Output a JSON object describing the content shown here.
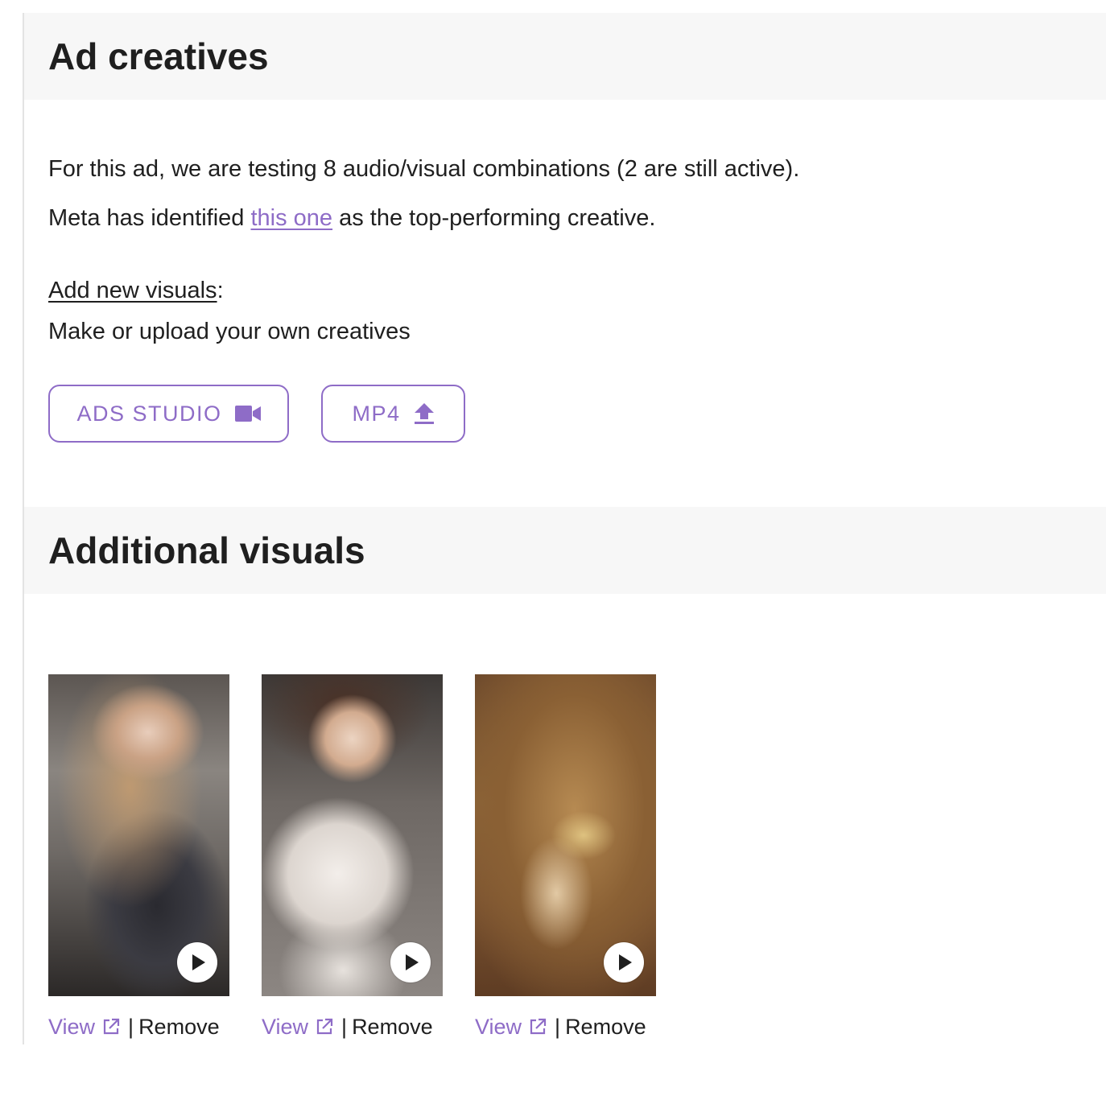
{
  "ad_creatives": {
    "title": "Ad creatives",
    "intro_line": "For this ad, we are testing 8 audio/visual combinations (2 are still active).",
    "meta_prefix": "Meta has identified ",
    "meta_link": "this one",
    "meta_suffix": " as the top-performing creative.",
    "add_new_link": "Add new visuals",
    "add_new_colon": ":",
    "make_upload": "Make or upload your own creatives",
    "buttons": {
      "ads_studio": "ADS STUDIO",
      "mp4": "MP4"
    }
  },
  "additional_visuals": {
    "title": "Additional visuals",
    "items": [
      {
        "view": "View",
        "separator": "|",
        "remove": "Remove",
        "icon": "play-icon"
      },
      {
        "view": "View",
        "separator": "|",
        "remove": "Remove",
        "icon": "play-icon"
      },
      {
        "view": "View",
        "separator": "|",
        "remove": "Remove",
        "icon": "play-icon"
      }
    ]
  },
  "colors": {
    "accent": "#8e6cc7",
    "text": "#1f1f1f",
    "header_bg": "#f7f7f7"
  }
}
